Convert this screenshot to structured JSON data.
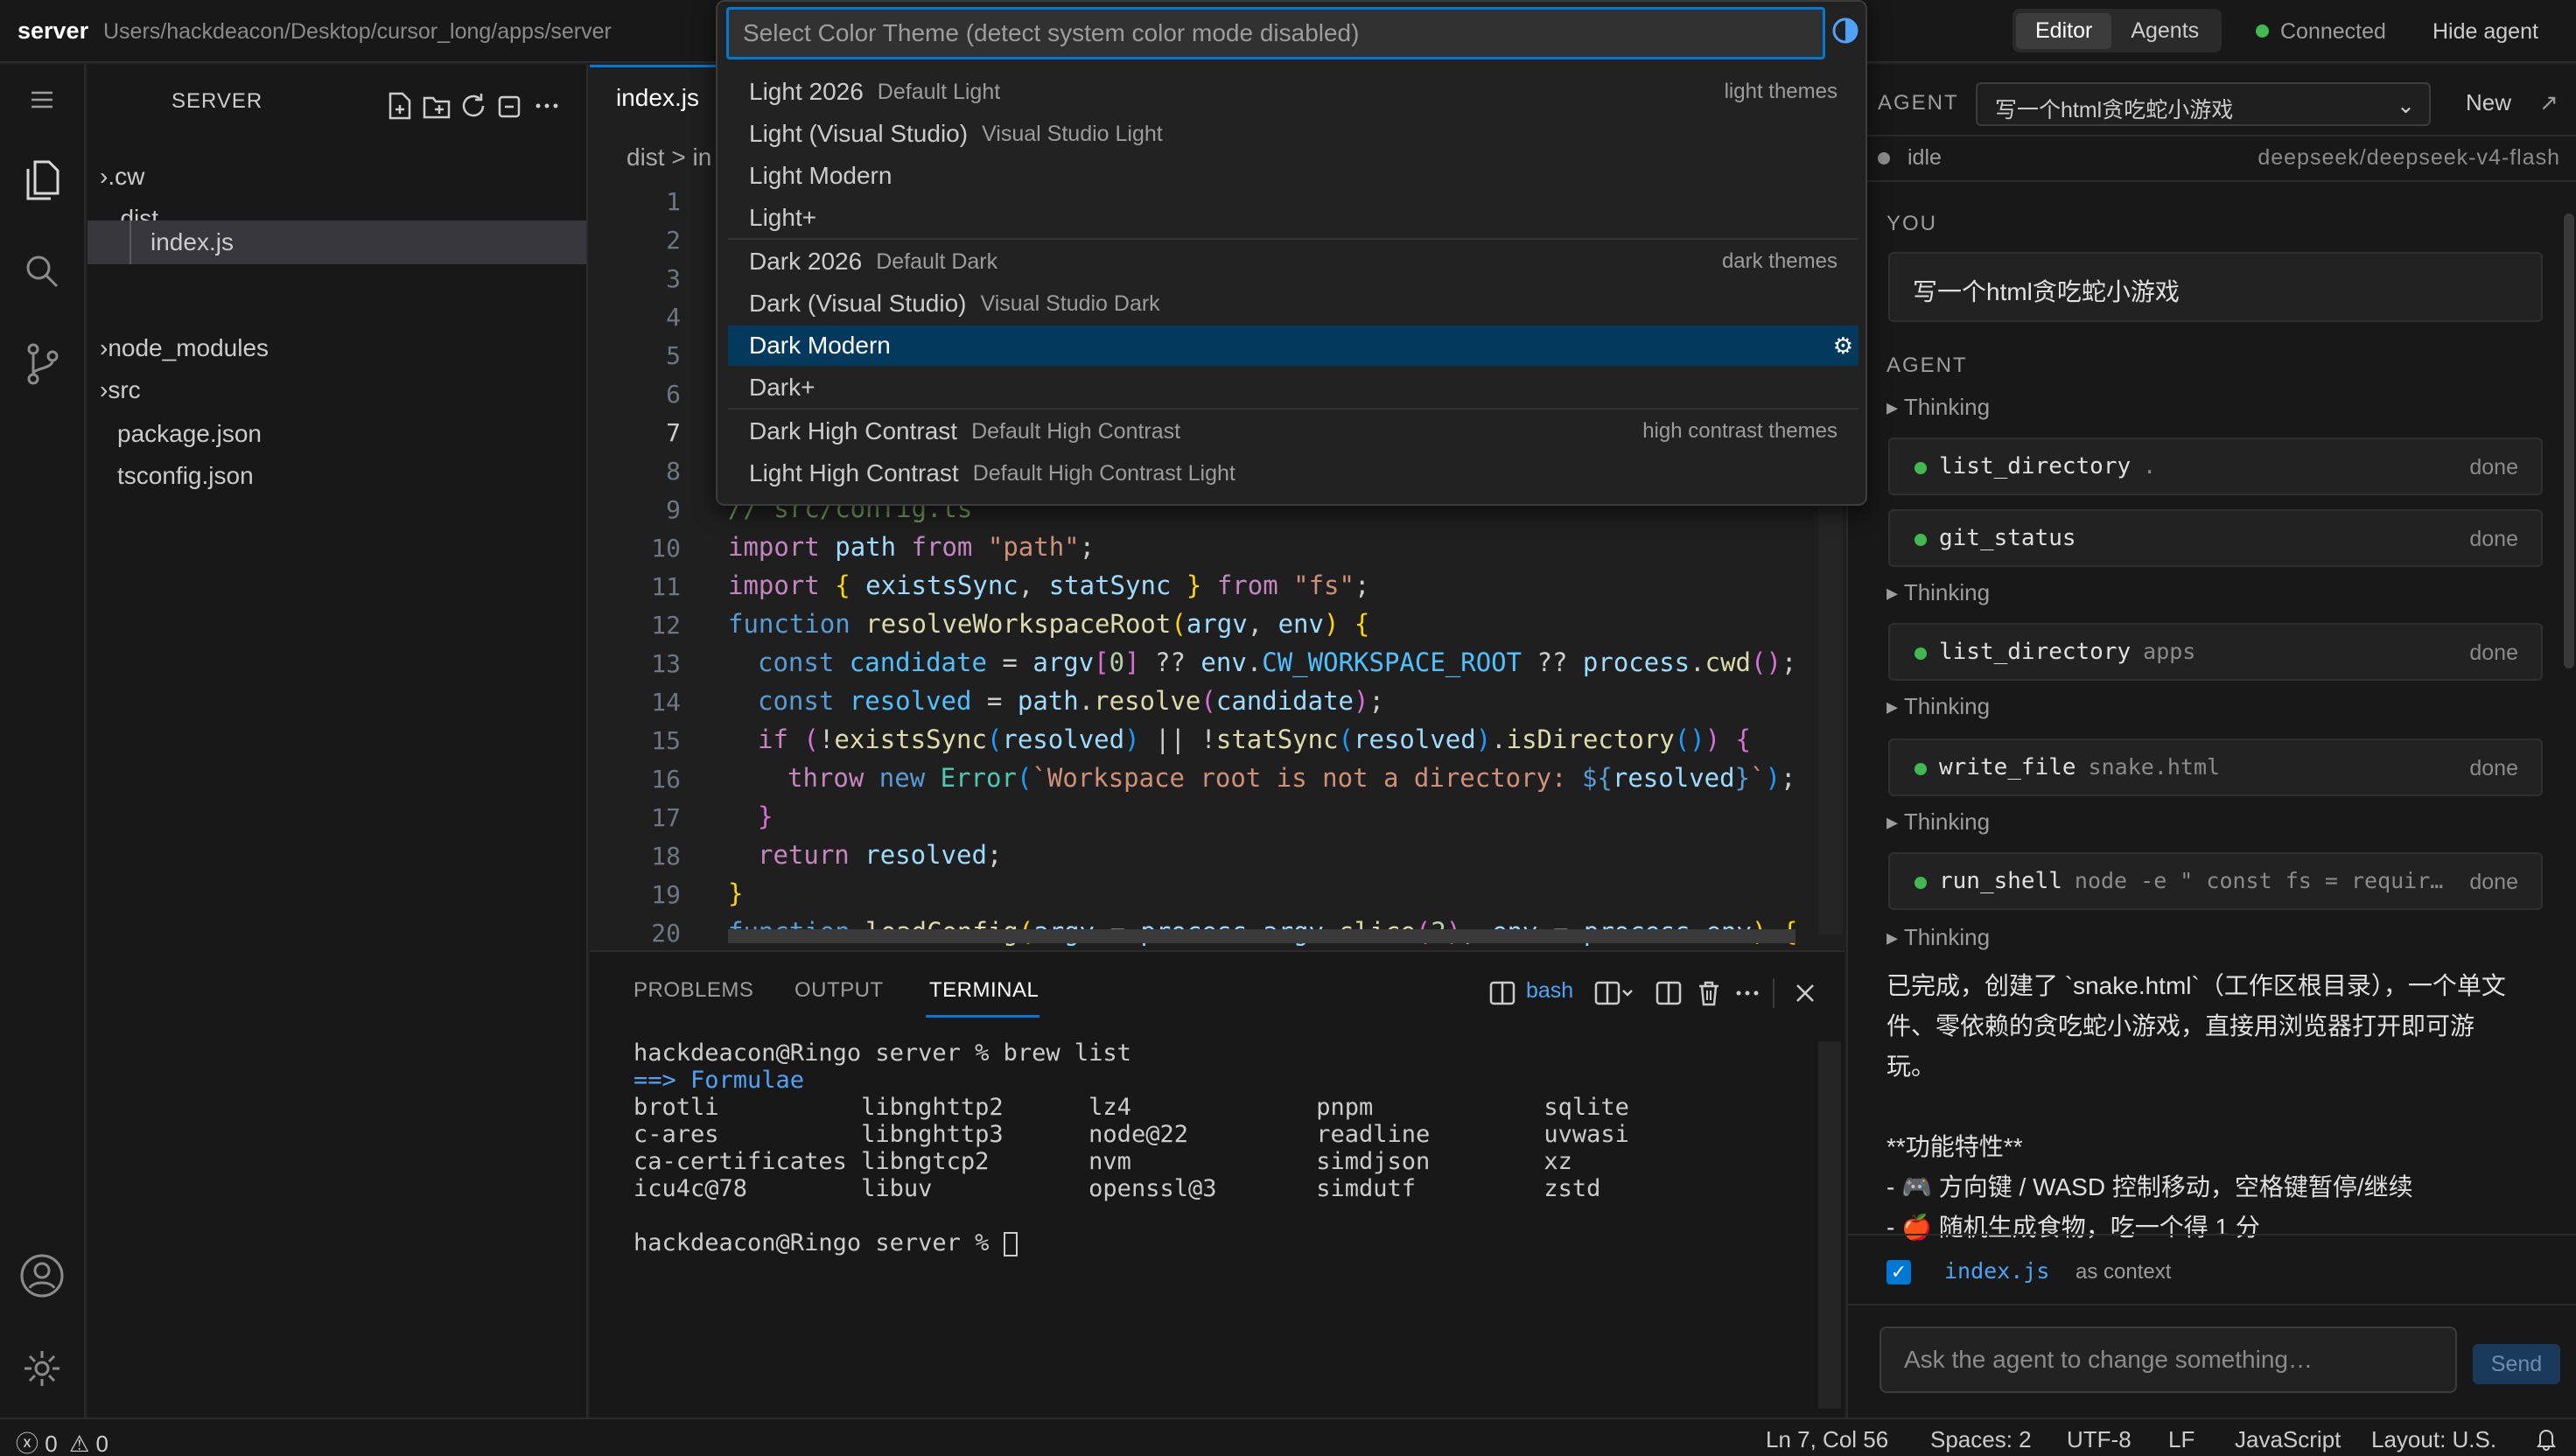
{
  "titlebar": {
    "title": "server",
    "path": "Users/hackdeacon/Desktop/cursor_long/apps/server",
    "segments": [
      "Editor",
      "Agents"
    ],
    "connection": "Connected",
    "hide_agent": "Hide agent"
  },
  "sidebar": {
    "title": "SERVER",
    "tree": [
      {
        "label": ".cw",
        "type": "folder-collapsed"
      },
      {
        "label": "dist",
        "type": "folder-expanded"
      },
      {
        "label": "index.js",
        "type": "file",
        "selected": true
      },
      {
        "label": "node_modules",
        "type": "folder-collapsed"
      },
      {
        "label": "src",
        "type": "folder-collapsed"
      },
      {
        "label": "package.json",
        "type": "file"
      },
      {
        "label": "tsconfig.json",
        "type": "file"
      }
    ]
  },
  "editor": {
    "tab": "index.js",
    "breadcrumb": "dist > in",
    "current_line": 7,
    "line_numbers": [
      "1",
      "2",
      "3",
      "4",
      "5",
      "6",
      "7",
      "8",
      "9",
      "10",
      "11",
      "12",
      "13",
      "14",
      "15",
      "16",
      "17",
      "18",
      "19",
      "20"
    ],
    "code_lines": {
      "l9": "// src/config.ts",
      "l10": [
        "import",
        "path",
        "from",
        "\"path\"",
        ";"
      ],
      "l11": [
        "import",
        "{",
        "existsSync",
        ",",
        "statSync",
        "}",
        "from",
        "\"fs\"",
        ";"
      ],
      "l12": [
        "function",
        "resolveWorkspaceRoot",
        "(",
        "argv",
        ", ",
        "env",
        ")",
        " {"
      ],
      "l13": [
        "const",
        "candidate",
        " = ",
        "argv",
        "[",
        "0",
        "]",
        " ?? ",
        "env",
        ".",
        "CW_WORKSPACE_ROOT",
        " ?? ",
        "process",
        ".",
        "cwd",
        "()",
        ";"
      ],
      "l14": [
        "const",
        "resolved",
        " = ",
        "path",
        ".",
        "resolve",
        "(",
        "candidate",
        ")",
        ";"
      ],
      "l15": [
        "if",
        " (",
        "!",
        "existsSync",
        "(",
        "resolved",
        ")",
        " || ",
        "!",
        "statSync",
        "(",
        "resolved",
        ")",
        ".",
        "isDirectory",
        "()",
        ")",
        " {"
      ],
      "l16": [
        "throw",
        "new",
        "Error",
        "(",
        "`Workspace root is not a directory: ",
        "${",
        "resolved",
        "}",
        "`",
        ")",
        ";"
      ],
      "l17": "}",
      "l18": [
        "return",
        "resolved",
        ";"
      ],
      "l19": "}",
      "l20": [
        "function",
        "loadConfig",
        "(",
        "argv",
        " = ",
        "process",
        ".",
        "argv",
        ".",
        "slice",
        "(",
        "2",
        ")",
        ", ",
        "env",
        " = ",
        "process",
        ".",
        "env",
        ")",
        " {"
      ]
    }
  },
  "panel": {
    "tabs": [
      "PROBLEMS",
      "OUTPUT",
      "TERMINAL"
    ],
    "active_tab": "TERMINAL",
    "shell": "bash",
    "terminal_lines": [
      "hackdeacon@Ringo server % brew list",
      "==> Formulae",
      "brotli          libnghttp2      lz4             pnpm            sqlite",
      "c-ares          libnghttp3      node@22         readline        uvwasi",
      "ca-certificates libngtcp2       nvm             simdjson        xz",
      "icu4c@78        libuv           openssl@3       simdutf         zstd",
      "",
      "hackdeacon@Ringo server % "
    ]
  },
  "agent": {
    "label": "AGENT",
    "selected_conversation": "写一个html贪吃蛇小游戏",
    "new": "New",
    "status": "idle",
    "model": "deepseek/deepseek-v4-flash",
    "you_label": "YOU",
    "you_message": "写一个html贪吃蛇小游戏",
    "agent_label": "AGENT",
    "thinking": "Thinking",
    "tools": [
      {
        "name": "list_directory",
        "arg": ".",
        "status": "done"
      },
      {
        "name": "git_status",
        "arg": "",
        "status": "done"
      },
      {
        "name": "list_directory",
        "arg": "apps",
        "status": "done"
      },
      {
        "name": "write_file",
        "arg": "snake.html",
        "status": "done"
      },
      {
        "name": "run_shell",
        "arg": "node -e \" const fs = requir…",
        "status": "done"
      }
    ],
    "reply": [
      "已完成，创建了 `snake.html`（工作区根目录），一个单文",
      "件、零依赖的贪吃蛇小游戏，直接用浏览器打开即可游",
      "玩。",
      "",
      "**功能特性**",
      "- 🎮 方向键 / WASD 控制移动，空格键暂停/继续",
      "- 🍎 随机生成食物，吃一个得 1 分"
    ],
    "context_file": "index.js",
    "context_label": "as context",
    "input_placeholder": "Ask the agent to change something…",
    "send": "Send"
  },
  "statusbar": {
    "errors": "0",
    "warnings": "0",
    "position": "Ln 7, Col 56",
    "spaces": "Spaces: 2",
    "encoding": "UTF-8",
    "eol": "LF",
    "language": "JavaScript",
    "layout": "Layout: U.S."
  },
  "quickpick": {
    "placeholder": "Select Color Theme (detect system color mode disabled)",
    "items": [
      {
        "label": "Light 2026",
        "desc": "Default Light",
        "group": "light themes"
      },
      {
        "label": "Light (Visual Studio)",
        "desc": "Visual Studio Light",
        "group": ""
      },
      {
        "label": "Light Modern",
        "desc": "",
        "group": ""
      },
      {
        "label": "Light+",
        "desc": "",
        "group": ""
      },
      {
        "label": "Dark 2026",
        "desc": "Default Dark",
        "group": "dark themes"
      },
      {
        "label": "Dark (Visual Studio)",
        "desc": "Visual Studio Dark",
        "group": ""
      },
      {
        "label": "Dark Modern",
        "desc": "",
        "group": "",
        "selected": true
      },
      {
        "label": "Dark+",
        "desc": "",
        "group": ""
      },
      {
        "label": "Dark High Contrast",
        "desc": "Default High Contrast",
        "group": "high contrast themes"
      },
      {
        "label": "Light High Contrast",
        "desc": "Default High Contrast Light",
        "group": ""
      }
    ]
  },
  "colors": {
    "accent": "#0078d4",
    "selection": "#04395e",
    "success": "#3fb950"
  },
  "icons": [
    "files-icon",
    "search-icon",
    "source-control-icon",
    "account-icon",
    "settings-gear-icon",
    "new-file-icon",
    "new-folder-icon",
    "refresh-icon",
    "collapse-all-icon",
    "more-icon",
    "contrast-icon",
    "split-icon",
    "trash-icon",
    "close-icon",
    "bell-icon",
    "chevron-down-icon",
    "popout-icon"
  ]
}
